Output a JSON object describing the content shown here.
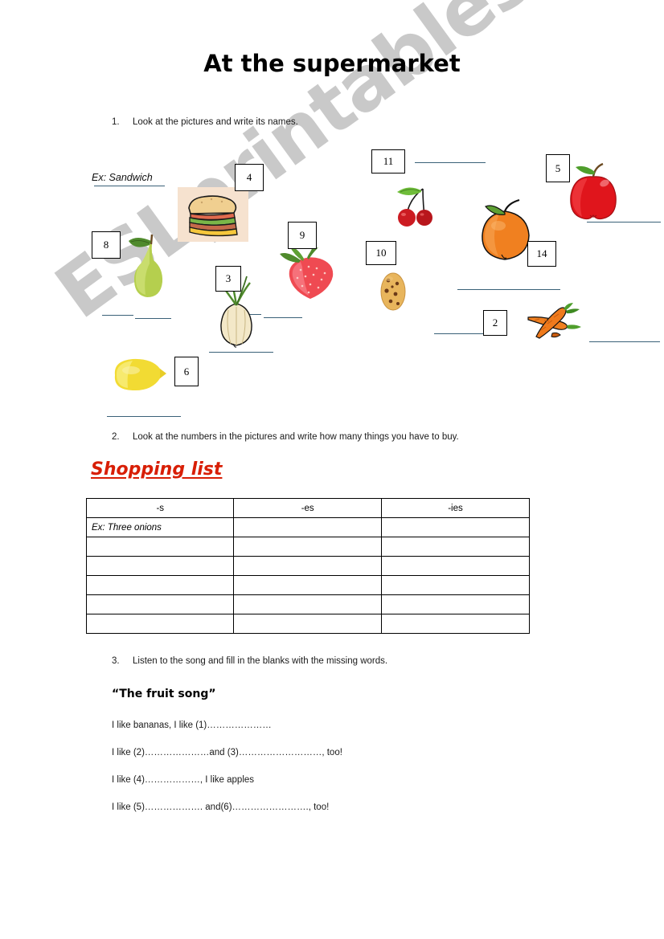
{
  "page": {
    "title": "At the supermarket",
    "watermark": "ESLprintables.com",
    "line_color": "#3a6178",
    "heading_color": "#d81e05",
    "watermark_color": "#c9c9c9"
  },
  "tasks": [
    {
      "number": "1.",
      "text": "Look at the pictures and write its names."
    },
    {
      "number": "2.",
      "text": "Look at the numbers in the pictures and write how many things you have to buy."
    },
    {
      "number": "3.",
      "text": "Listen to the song and fill in the blanks with the missing words."
    }
  ],
  "exercise1": {
    "example_label": "Ex: Sandwich",
    "items": [
      {
        "name": "sandwich",
        "number": "4"
      },
      {
        "name": "pear",
        "number": "8"
      },
      {
        "name": "onion",
        "number": "3"
      },
      {
        "name": "strawberry",
        "number": "9"
      },
      {
        "name": "lemon",
        "number": "6"
      },
      {
        "name": "cherries",
        "number": "11"
      },
      {
        "name": "cookie",
        "number": "10"
      },
      {
        "name": "orange",
        "number": "14"
      },
      {
        "name": "apple",
        "number": "5"
      },
      {
        "name": "carrots",
        "number": "2"
      }
    ]
  },
  "shopping_list": {
    "heading": "Shopping list",
    "columns": [
      "-s",
      "-es",
      "-ies"
    ],
    "rows": [
      [
        "Ex: Three onions",
        "",
        ""
      ],
      [
        "",
        "",
        ""
      ],
      [
        "",
        "",
        ""
      ],
      [
        "",
        "",
        ""
      ],
      [
        "",
        "",
        ""
      ],
      [
        "",
        "",
        ""
      ]
    ]
  },
  "song": {
    "title": "“The fruit song”",
    "lines": [
      "I like bananas, I like (1)…………………",
      "I like (2)…………………and (3)………………………, too!",
      "I like (4)………………, I like apples",
      "I like (5)………………. and(6)……………………., too!"
    ]
  }
}
